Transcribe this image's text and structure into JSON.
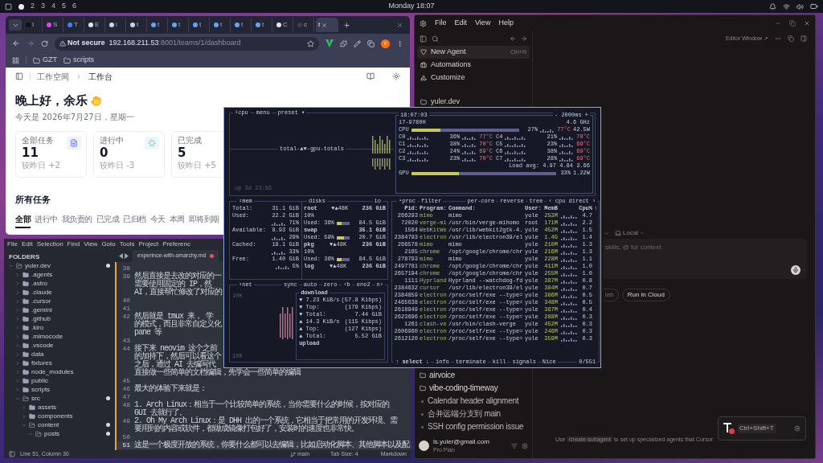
{
  "top_bar": {
    "workspaces": [
      {
        "selected": true
      },
      {
        "label": "2",
        "selected": false
      },
      {
        "label": "3",
        "selected": false
      },
      {
        "label": "4",
        "selected": false
      },
      {
        "label": "5",
        "selected": false
      },
      {
        "label": "6",
        "selected": false
      }
    ],
    "clock": "Monday 18:07"
  },
  "browser": {
    "tabs": [
      {
        "label": "I",
        "selected": false
      },
      {
        "label": "S",
        "selected": false
      },
      {
        "label": "T",
        "selected": false
      },
      {
        "label": "E",
        "selected": false
      },
      {
        "label": "i",
        "selected": false
      },
      {
        "label": "t",
        "selected": false
      },
      {
        "label": "t",
        "selected": false
      },
      {
        "label": "t",
        "selected": false
      },
      {
        "label": "t",
        "selected": false
      },
      {
        "label": "t",
        "selected": false
      },
      {
        "label": "t",
        "selected": false
      },
      {
        "label": "t",
        "selected": false
      },
      {
        "label": "C",
        "selected": false
      },
      {
        "label": "c",
        "selected": false
      },
      {
        "label": "t",
        "selected": true
      }
    ],
    "security": "Not secure",
    "url_host": "192.168.211.53",
    "url_path": ":8001/teams/1/dashboard",
    "profile": "r",
    "bookmarks": [
      "GZT",
      "scripts"
    ],
    "page": {
      "breadcrumb": [
        "工作空间",
        "工作台"
      ],
      "greeting": "晚上好，余乐",
      "date": "今天是 2026年7月27日，星期一",
      "cards": [
        {
          "label": "全部任务",
          "value": "11",
          "delta": "较昨日 +2"
        },
        {
          "label": "进行中",
          "value": "0",
          "delta": "较昨日 -3"
        },
        {
          "label": "已完成",
          "value": "5",
          "delta": "较昨日 +5"
        }
      ],
      "section_title": "所有任务",
      "filters": [
        {
          "label": "全部",
          "selected": true
        },
        {
          "label": "进行中",
          "selected": false
        },
        {
          "label": "我负责的",
          "selected": false
        },
        {
          "label": "已完成",
          "selected": false
        },
        {
          "label": "已归档",
          "selected": false
        },
        {
          "label": "今天",
          "selected": false
        },
        {
          "label": "本周",
          "selected": false
        },
        {
          "label": "即将到期",
          "selected": false
        }
      ]
    }
  },
  "editor": {
    "menu": [
      "File",
      "Edit",
      "Selection",
      "Find",
      "View",
      "Goto",
      "Tools",
      "Project",
      "Preferenc"
    ],
    "sidebar_title": "FOLDERS",
    "tree": [
      {
        "name": "yuler.dev",
        "expanded": true,
        "children": [
          {
            "name": ".agents",
            "expanded": false
          },
          {
            "name": ".astro",
            "expanded": false
          },
          {
            "name": ".claude",
            "expanded": false
          },
          {
            "name": ".cursor",
            "expanded": false
          },
          {
            "name": ".gemini",
            "expanded": false
          },
          {
            "name": ".github",
            "expanded": false
          },
          {
            "name": ".kiro",
            "expanded": false
          },
          {
            "name": ".mimocode",
            "expanded": false
          },
          {
            "name": ".vscode",
            "expanded": false
          },
          {
            "name": "data",
            "expanded": false
          },
          {
            "name": "fixtures",
            "expanded": false
          },
          {
            "name": "node_modules",
            "expanded": false
          },
          {
            "name": "public",
            "expanded": false
          },
          {
            "name": "scripts",
            "expanded": false
          },
          {
            "name": "src",
            "expanded": true,
            "children": [
              {
                "name": "assets",
                "expanded": false
              },
              {
                "name": "components",
                "expanded": false
              },
              {
                "name": "content",
                "expanded": true,
                "children": [
                  {
                    "name": "posts",
                    "expanded": true
                  }
                ]
              }
            ]
          }
        ]
      }
    ],
    "tab": {
      "label": "experince-with-omarchy.md",
      "modified": true
    },
    "lines": [
      {
        "number": "38",
        "current": false
      },
      {
        "number": "39",
        "current": false,
        "text": [
          "然后直接是去改的对应的一",
          "需要使用固定的 IP，然",
          "AI，直接帮忙修改了对应的"
        ]
      },
      {
        "number": "40",
        "current": false
      },
      {
        "number": "41",
        "current": false
      },
      {
        "number": "42",
        "current": false,
        "text": [
          "然后就是 tmux 来， 学",
          "的模式，而且非常自定义化",
          "pane 等"
        ]
      },
      {
        "number": "43",
        "current": false
      },
      {
        "number": "44",
        "current": false,
        "text": [
          "接下来 neovim 这个之前",
          "的加持下，然后可以看这个",
          "之后，通过 AI 去编写代",
          "直接做一些简单的文档编辑，先学会一些简单的编辑"
        ]
      },
      {
        "number": "45",
        "current": false
      },
      {
        "number": "46",
        "current": false,
        "text": [
          "最大的体验下来就是："
        ]
      },
      {
        "number": "47",
        "current": false
      },
      {
        "number": "48",
        "current": false,
        "text": [
          "1. Arch Linux：相当于一个比较简单的系统，当你需要什么的时候，按对应的",
          "GUI 去就行了。"
        ]
      },
      {
        "number": "49",
        "current": false,
        "text": [
          "2. Oh My Arch Linux：是 DHH 出的一个系统，它相当于把常用的开发环境、需",
          "要用到的内容或软件，都做成镜像打包好了，安装时的速度也非常快。"
        ]
      },
      {
        "number": "50",
        "current": false
      },
      {
        "number": "51",
        "current": true,
        "text": [
          "这是一个极度开放的系统，你要什么都可以去编辑，比如启动化脚本、其他脚本以及配"
        ]
      }
    ],
    "status": {
      "position": "Line 51, Column 30",
      "branch": "main",
      "tab_size": "Tab Size: 4",
      "syntax": "Markdown"
    }
  },
  "terminal": {
    "cpu": {
      "tabs": [
        "¹cpu",
        "menu",
        "preset ▾"
      ],
      "graph_label": "total-▲▼-gpu-totals",
      "uptime": "up 3d 23:55",
      "clock": "18:07:03",
      "refresh": "- 2000ms +",
      "model": "i7-9780H",
      "freq": "4.6 GHz",
      "total": {
        "label": "CPU",
        "level": 0.27,
        "pct": "27%",
        "temp": "77°C",
        "power": "42.5W"
      },
      "cores": [
        {
          "name": "C0",
          "pct": "36%",
          "temp": "77°C"
        },
        {
          "name": "C4",
          "pct": "21%",
          "temp": "70°C"
        },
        {
          "name": "C1",
          "pct": "38%",
          "temp": "70°C"
        },
        {
          "name": "C5",
          "pct": "23%",
          "temp": "69°C"
        },
        {
          "name": "C2",
          "pct": "24%",
          "temp": "69°C"
        },
        {
          "name": "C6",
          "pct": "38%",
          "temp": "69°C"
        },
        {
          "name": "C3",
          "pct": "23%",
          "temp": "70°C"
        },
        {
          "name": "C7",
          "pct": "28%",
          "temp": "69°C"
        }
      ],
      "load": "Load avg: 4.97 4.84 3.66",
      "gpu": {
        "label": "GPU",
        "level": 0.33,
        "pct": "33%",
        "power": "1.22W"
      }
    },
    "mem": {
      "title": "²mem",
      "rows": [
        {
          "label": "Total:",
          "value": "31.1 GiB"
        },
        {
          "label": "Used:",
          "value": "22.2 GiB"
        },
        {
          "pct": "71%"
        },
        {
          "label": "Available:",
          "value": "8.93 GiB"
        },
        {
          "pct": "29%"
        },
        {
          "label": "Cached:",
          "value": "18.1 GiB"
        },
        {
          "pct": "33%"
        },
        {
          "label": "Free:",
          "value": "1.40 GiB"
        },
        {
          "pct": "5%"
        }
      ]
    },
    "disks": {
      "title": "disks",
      "io_title": "io",
      "items": [
        {
          "name": "root",
          "io": "▼▲48K",
          "size": "236 GiB",
          "pct": "10%",
          "used_label": "Used:",
          "used_pct": "36%",
          "level": 0.36,
          "used_size": "84.5 GiB"
        },
        {
          "name": "swap",
          "size": "35.1 GiB",
          "used_label": "Used:",
          "used_pct": "59%",
          "level": 0.59,
          "used_size": "20.7 GiB"
        },
        {
          "name": "pkg",
          "io": "▼▲48K",
          "size": "236 GiB",
          "pct": "10%",
          "used_label": "Used:",
          "used_pct": "36%",
          "level": 0.36,
          "used_size": "84.5 GiB"
        },
        {
          "name": "log",
          "io": "▼▲48K",
          "size": "236 GiB"
        }
      ]
    },
    "net": {
      "title": "³net",
      "controls": [
        "sync",
        "auto",
        "zero",
        "‹b",
        "eno2",
        "n›"
      ],
      "scale_top": "10K",
      "scale_bottom": "10K",
      "box_title": "download",
      "box_footer": "upload",
      "rows": [
        {
          "label": "▼ 7.23 KiB/s",
          "value": "(57.8 Kibps)"
        },
        {
          "label": "▼ Top:",
          "value": "(179 Kibps)"
        },
        {
          "label": "▼ Total:",
          "value": "7.44 GiB"
        },
        {
          "label": "▲ 14.3 KiB/s",
          "value": "(115 Kibps)"
        },
        {
          "label": "▲ Top:",
          "value": "(127 Kibps)"
        },
        {
          "label": "▲ Total:",
          "value": "5.52 GiB"
        }
      ]
    },
    "proc": {
      "title": "⁴proc",
      "filter": "filter",
      "options": [
        "per-core",
        "reverse",
        "tree"
      ],
      "sort": "‹ cpu direct ›",
      "columns": [
        "Pid:",
        "Program:",
        "Command:",
        "User:",
        "MemB",
        "Cpu%"
      ],
      "sort_arrow": "↑",
      "rows": [
        [
          "266293",
          "mimo",
          "mimo",
          "yule",
          "253M",
          "4.7"
        ],
        [
          "72020",
          "verge-mi",
          "/usr/bin/verge-mihomo",
          "root",
          "171M",
          "2.2"
        ],
        [
          "1564",
          "WebKitWe",
          "/usr/lib/webkit2gtk-4.",
          "yule",
          "452M",
          "1.5"
        ],
        [
          "2384793",
          "electron",
          "/usr/lib/electron39/el",
          "yule",
          "1.4G",
          "1.4"
        ],
        [
          "266578",
          "mimo",
          "mimo",
          "yule",
          "210M",
          "1.3"
        ],
        [
          "2165",
          "chrome",
          "/opt/google/chrome/chr",
          "yule",
          "216M",
          "1.3"
        ],
        [
          "278793",
          "mimo",
          "mimo",
          "yule",
          "228M",
          "1.1"
        ],
        [
          "2497781",
          "chrome",
          "/opt/google/chrome/chr",
          "yule",
          "411M",
          "1.0"
        ],
        [
          "2657194",
          "chrome",
          "/opt/google/chrome/chr",
          "yule",
          "255M",
          "1.0"
        ],
        [
          "1111",
          "Hyprland",
          "Hyprland --watchdog-fd",
          "yule",
          "387M",
          "0.8"
        ],
        [
          "2384632",
          "cursor",
          "/usr/lib/electron39/el",
          "yule",
          "384M",
          "0.7"
        ],
        [
          "2384859",
          "electron",
          "/proc/self/exe --type=",
          "yule",
          "386M",
          "0.5"
        ],
        [
          "2465638",
          "electron",
          "/proc/self/exe --type=",
          "yule",
          "348M",
          "0.5"
        ],
        [
          "2618949",
          "electron",
          "/proc/self/exe --type=",
          "yule",
          "367M",
          "0.4"
        ],
        [
          "2623696",
          "electron",
          "/proc/self/exe --type=",
          "yule",
          "288M",
          "0.3"
        ],
        [
          "1261",
          "clash-ve",
          "/usr/bin/clash-verge",
          "yule",
          "452M",
          "0.3"
        ],
        [
          "2606960",
          "electron",
          "/proc/self/exe --type=",
          "yule",
          "246M",
          "0.3"
        ],
        [
          "2612120",
          "electron",
          "/proc/self/exe --type=",
          "yule",
          "359M",
          "0.3"
        ]
      ],
      "footer": [
        "↑ select ↓",
        "info",
        "terminate",
        "kill",
        "signals",
        "Nice"
      ],
      "count": "0/551"
    }
  },
  "agent": {
    "menu": [
      "File",
      "Edit",
      "View",
      "Help"
    ],
    "nav": [
      {
        "label": "New Agent",
        "shortcut": "Ctrl+N",
        "selected": true
      },
      {
        "label": "Automations",
        "selected": false
      },
      {
        "label": "Customize",
        "selected": false
      }
    ],
    "projects_top": [
      "yuler.dev"
    ],
    "projects": [
      {
        "kind": "folder",
        "label": "airvoice"
      },
      {
        "kind": "folder",
        "label": "vibe-coding-timeway"
      },
      {
        "kind": "chat",
        "label": "Calendar header alignment"
      },
      {
        "kind": "chat",
        "label": "合并远端分支到 main"
      },
      {
        "kind": "chat",
        "label": "SSH config permission issue"
      }
    ],
    "account": {
      "email": "ls.yuler@gmail.com",
      "plan": "Pro Plan"
    },
    "editor_window": "Editor Window ↗",
    "location": "Local",
    "placeholder": "skills, @ for context",
    "actions": [
      "lab",
      "Run in Cloud"
    ],
    "hint": {
      "before": "Use",
      "command": "/create-subagent",
      "after": "to set up specialized agents that Cursor"
    },
    "toast": {
      "shortcut": "Ctrl+Shift+T"
    }
  }
}
